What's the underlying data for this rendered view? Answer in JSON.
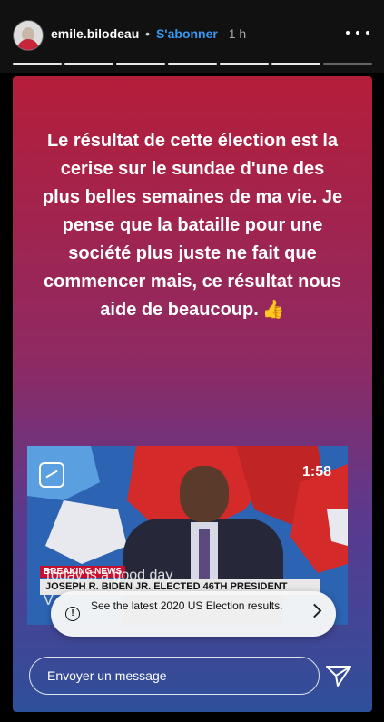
{
  "header": {
    "username": "emile.bilodeau",
    "separator": "•",
    "follow_label": "S'abonner",
    "time": "1 h"
  },
  "progress": {
    "segments": 7,
    "active": 6
  },
  "story": {
    "text": "Le résultat de cette élection est la cerise sur le sundae d'une des plus belles semaines de ma vie. Je pense que la bataille pour une société plus juste ne fait que commencer mais, ce résultat nous aide de beaucoup.",
    "emoji": "👍"
  },
  "video": {
    "duration": "1:58",
    "breaking_label": "BREAKING NEWS",
    "chyron": "JOSEPH R. BIDEN JR. ELECTED 46TH PRESIDENT",
    "caption_line1": "Today is a good day",
    "caption_line2": "V"
  },
  "toast": {
    "info_symbol": "!",
    "text": "See the latest 2020 US Election results."
  },
  "reply": {
    "placeholder": "Envoyer un message"
  },
  "colors": {
    "follow": "#3897f0",
    "gradient_top": "#b51e3a",
    "gradient_bottom": "#2e4f9a"
  },
  "icons": [
    "avatar",
    "more-options-icon",
    "igtv-icon",
    "info-icon",
    "chevron-right-icon",
    "send-icon"
  ]
}
